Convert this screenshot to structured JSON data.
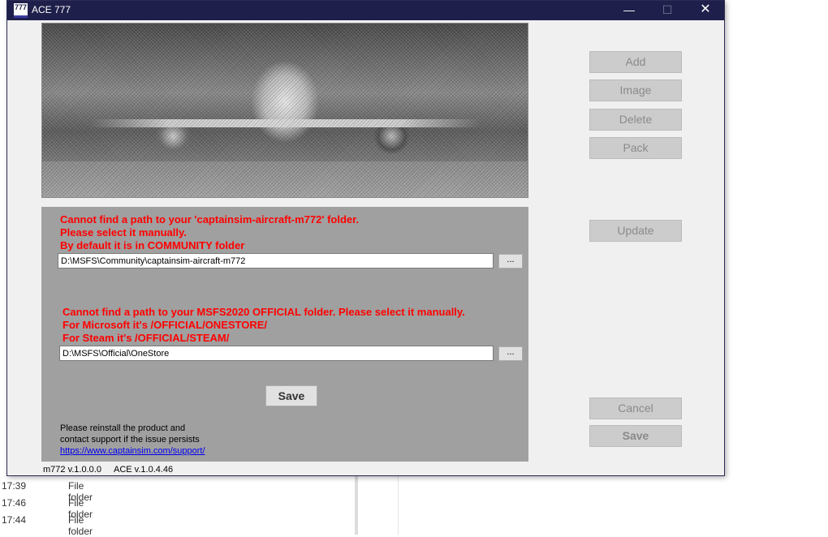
{
  "window": {
    "title": "ACE 777",
    "icon_text": "777",
    "minimize_glyph": "—",
    "maximize_glyph": "☐",
    "close_glyph": "✕"
  },
  "errors": {
    "aircraft": {
      "line1": "Cannot find a path to your 'captainsim-aircraft-m772' folder.",
      "line2": "Please select it manually.",
      "line3": "By default it is in COMMUNITY folder",
      "path_value": "D:\\MSFS\\Community\\captainsim-aircraft-m772",
      "browse_label": "..."
    },
    "official": {
      "line1": "Cannot find a path to your MSFS2020 OFFICIAL folder. Please select it manually.",
      "line2": "For Microsoft it's /OFFICIAL/ONESTORE/",
      "line3": "For Steam it's /OFFICIAL/STEAM/",
      "path_value": "D:\\MSFS\\Official\\OneStore",
      "browse_label": "..."
    },
    "save_label": "Save",
    "note_line1": "Please reinstall the product and",
    "note_line2": "contact support if the issue persists",
    "support_link": "https://www.captainsim.com/support/"
  },
  "side_buttons": {
    "add": "Add",
    "image": "Image",
    "delete": "Delete",
    "pack": "Pack",
    "update": "Update",
    "cancel": "Cancel",
    "save": "Save"
  },
  "versions": {
    "model": "m772 v.1.0.0.0",
    "ace": "ACE v.1.0.4.46"
  },
  "background": {
    "rows": [
      {
        "time": "17:39",
        "type": "File folder"
      },
      {
        "time": "17:46",
        "type": "File folder"
      },
      {
        "time": "17:44",
        "type": "File folder"
      }
    ]
  }
}
